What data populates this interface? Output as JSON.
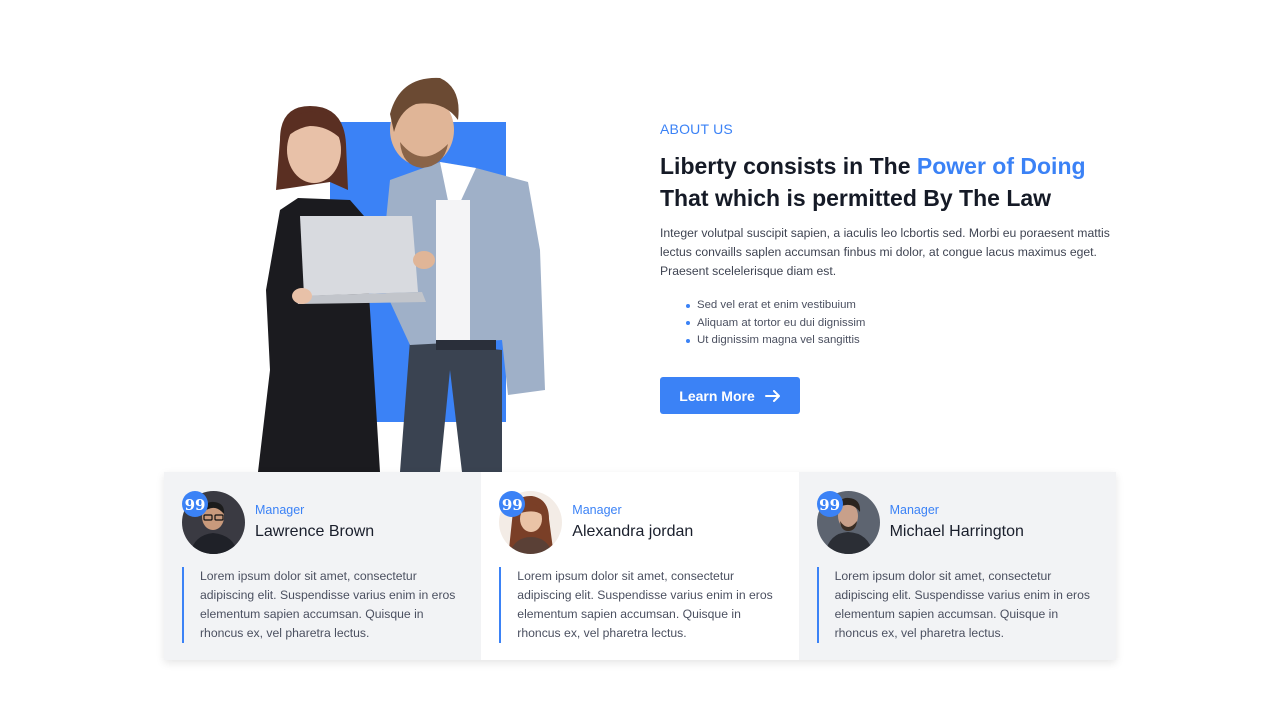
{
  "about": {
    "eyebrow": "ABOUT US",
    "headline_part1": "Liberty consists in The ",
    "headline_accent": "Power of Doing",
    "headline_part2": "That which is permitted By The Law",
    "intro": "Integer volutpal suscipit sapien, a iaculis leo lcbortis sed. Morbi eu poraesent mattis lectus convaills saplen accumsan finbus mi dolor, at congue lacus maximus eget. Praesent scelelerisque diam est.",
    "bullets": [
      "Sed vel erat et enim vestibuium",
      "Aliquam at tortor eu dui dignissim",
      "Ut dignissim magna vel sangittis"
    ],
    "cta_label": "Learn More",
    "cta_icon": "arrow-right-icon"
  },
  "testimonials": [
    {
      "role": "Manager",
      "name": "Lawrence Brown",
      "quote_mark": "99",
      "text": "Lorem ipsum dolor sit amet, consectetur adipiscing elit. Suspendisse varius enim in eros elementum sapien accumsan. Quisque in rhoncus ex, vel pharetra lectus."
    },
    {
      "role": "Manager",
      "name": "Alexandra jordan",
      "quote_mark": "99",
      "text": "Lorem ipsum dolor sit amet, consectetur adipiscing elit. Suspendisse varius enim in eros elementum sapien accumsan. Quisque in rhoncus ex, vel pharetra lectus."
    },
    {
      "role": "Manager",
      "name": "Michael Harrington",
      "quote_mark": "99",
      "text": "Lorem ipsum dolor sit amet, consectetur adipiscing elit. Suspendisse varius enim in eros elementum sapien accumsan. Quisque in rhoncus ex, vel pharetra lectus."
    }
  ],
  "colors": {
    "accent": "#3b82f6",
    "heading": "#151a26",
    "body_text": "#4b5060",
    "card_bg": "#f2f3f5"
  }
}
